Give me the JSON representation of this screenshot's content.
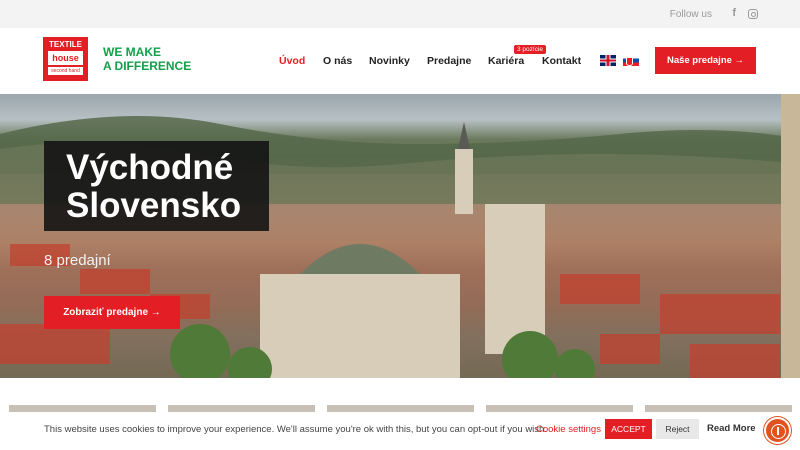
{
  "topbar": {
    "follow_label": "Follow us",
    "facebook_icon": "f"
  },
  "logo": {
    "line1": "TEXTILE",
    "line2": "house",
    "line3": "second hand"
  },
  "slogan": {
    "line1": "WE MAKE",
    "line2": "A DIFFERENCE"
  },
  "nav": {
    "items": [
      "Úvod",
      "O nás",
      "Novinky",
      "Predajne",
      "Kariéra",
      "Kontakt"
    ],
    "career_badge": "3 pozície",
    "cta": "Naše predajne →"
  },
  "hero": {
    "title_line1": "Východné",
    "title_line2": "Slovensko",
    "subtitle": "8 predajní",
    "button": "Zobraziť predajne →"
  },
  "cookie": {
    "message": "This website uses cookies to improve your experience. We'll assume you're ok with this, but you can opt-out if you wish.",
    "settings": "Cookie settings",
    "accept": "ACCEPT",
    "reject": "Reject",
    "read_more": "Read More"
  },
  "colors": {
    "brand_red": "#e31e24",
    "slogan_green": "#14a04b",
    "accessibility_orange": "#e0521e"
  },
  "icons": [
    "facebook-icon",
    "instagram-icon",
    "flag-en-icon",
    "flag-sk-icon",
    "arrow-right-icon",
    "accessibility-icon"
  ]
}
